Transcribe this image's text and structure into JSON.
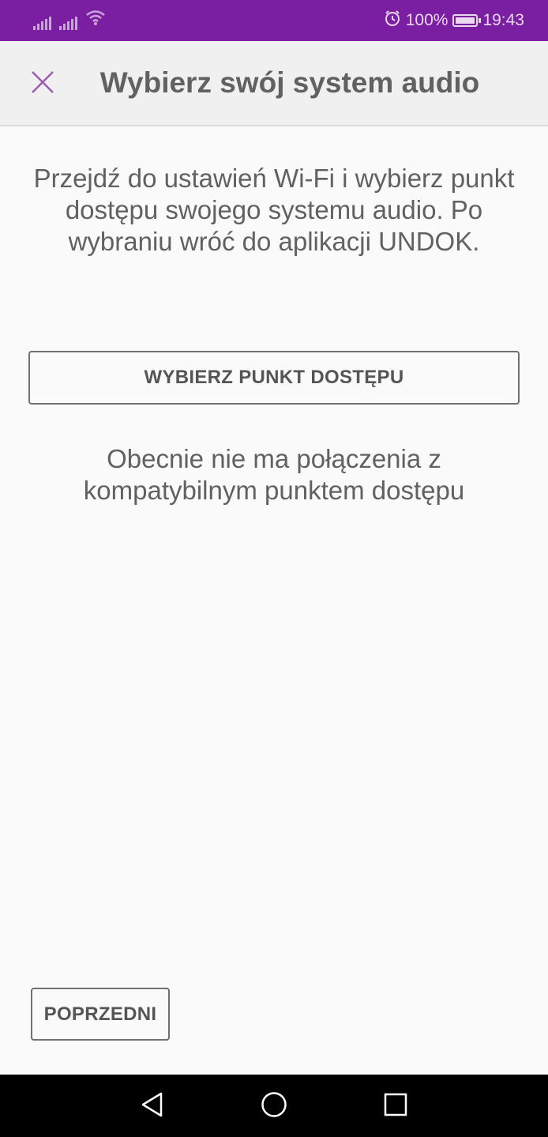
{
  "status_bar": {
    "battery_text": "100%",
    "time": "19:43",
    "color": "#7b1fa2",
    "icons": [
      "signal-icon",
      "signal-icon",
      "wifi-icon",
      "alarm-icon",
      "battery-icon"
    ]
  },
  "app_bar": {
    "title": "Wybierz swój system audio",
    "close_icon": "close-icon",
    "accent": "#9c5bb5"
  },
  "content": {
    "instructions": "Przejdź do ustawień Wi-Fi i wybierz punkt dostępu swojego systemu audio. Po wybraniu wróć do aplikacji UNDOK.",
    "select_ap_label": "WYBIERZ PUNKT DOSTĘPU",
    "no_connection": "Obecnie nie ma połączenia z kompatybilnym punktem dostępu"
  },
  "footer": {
    "previous_label": "POPRZEDNI"
  },
  "nav_bar": {
    "icons": [
      "back-icon",
      "home-icon",
      "recents-icon"
    ]
  }
}
